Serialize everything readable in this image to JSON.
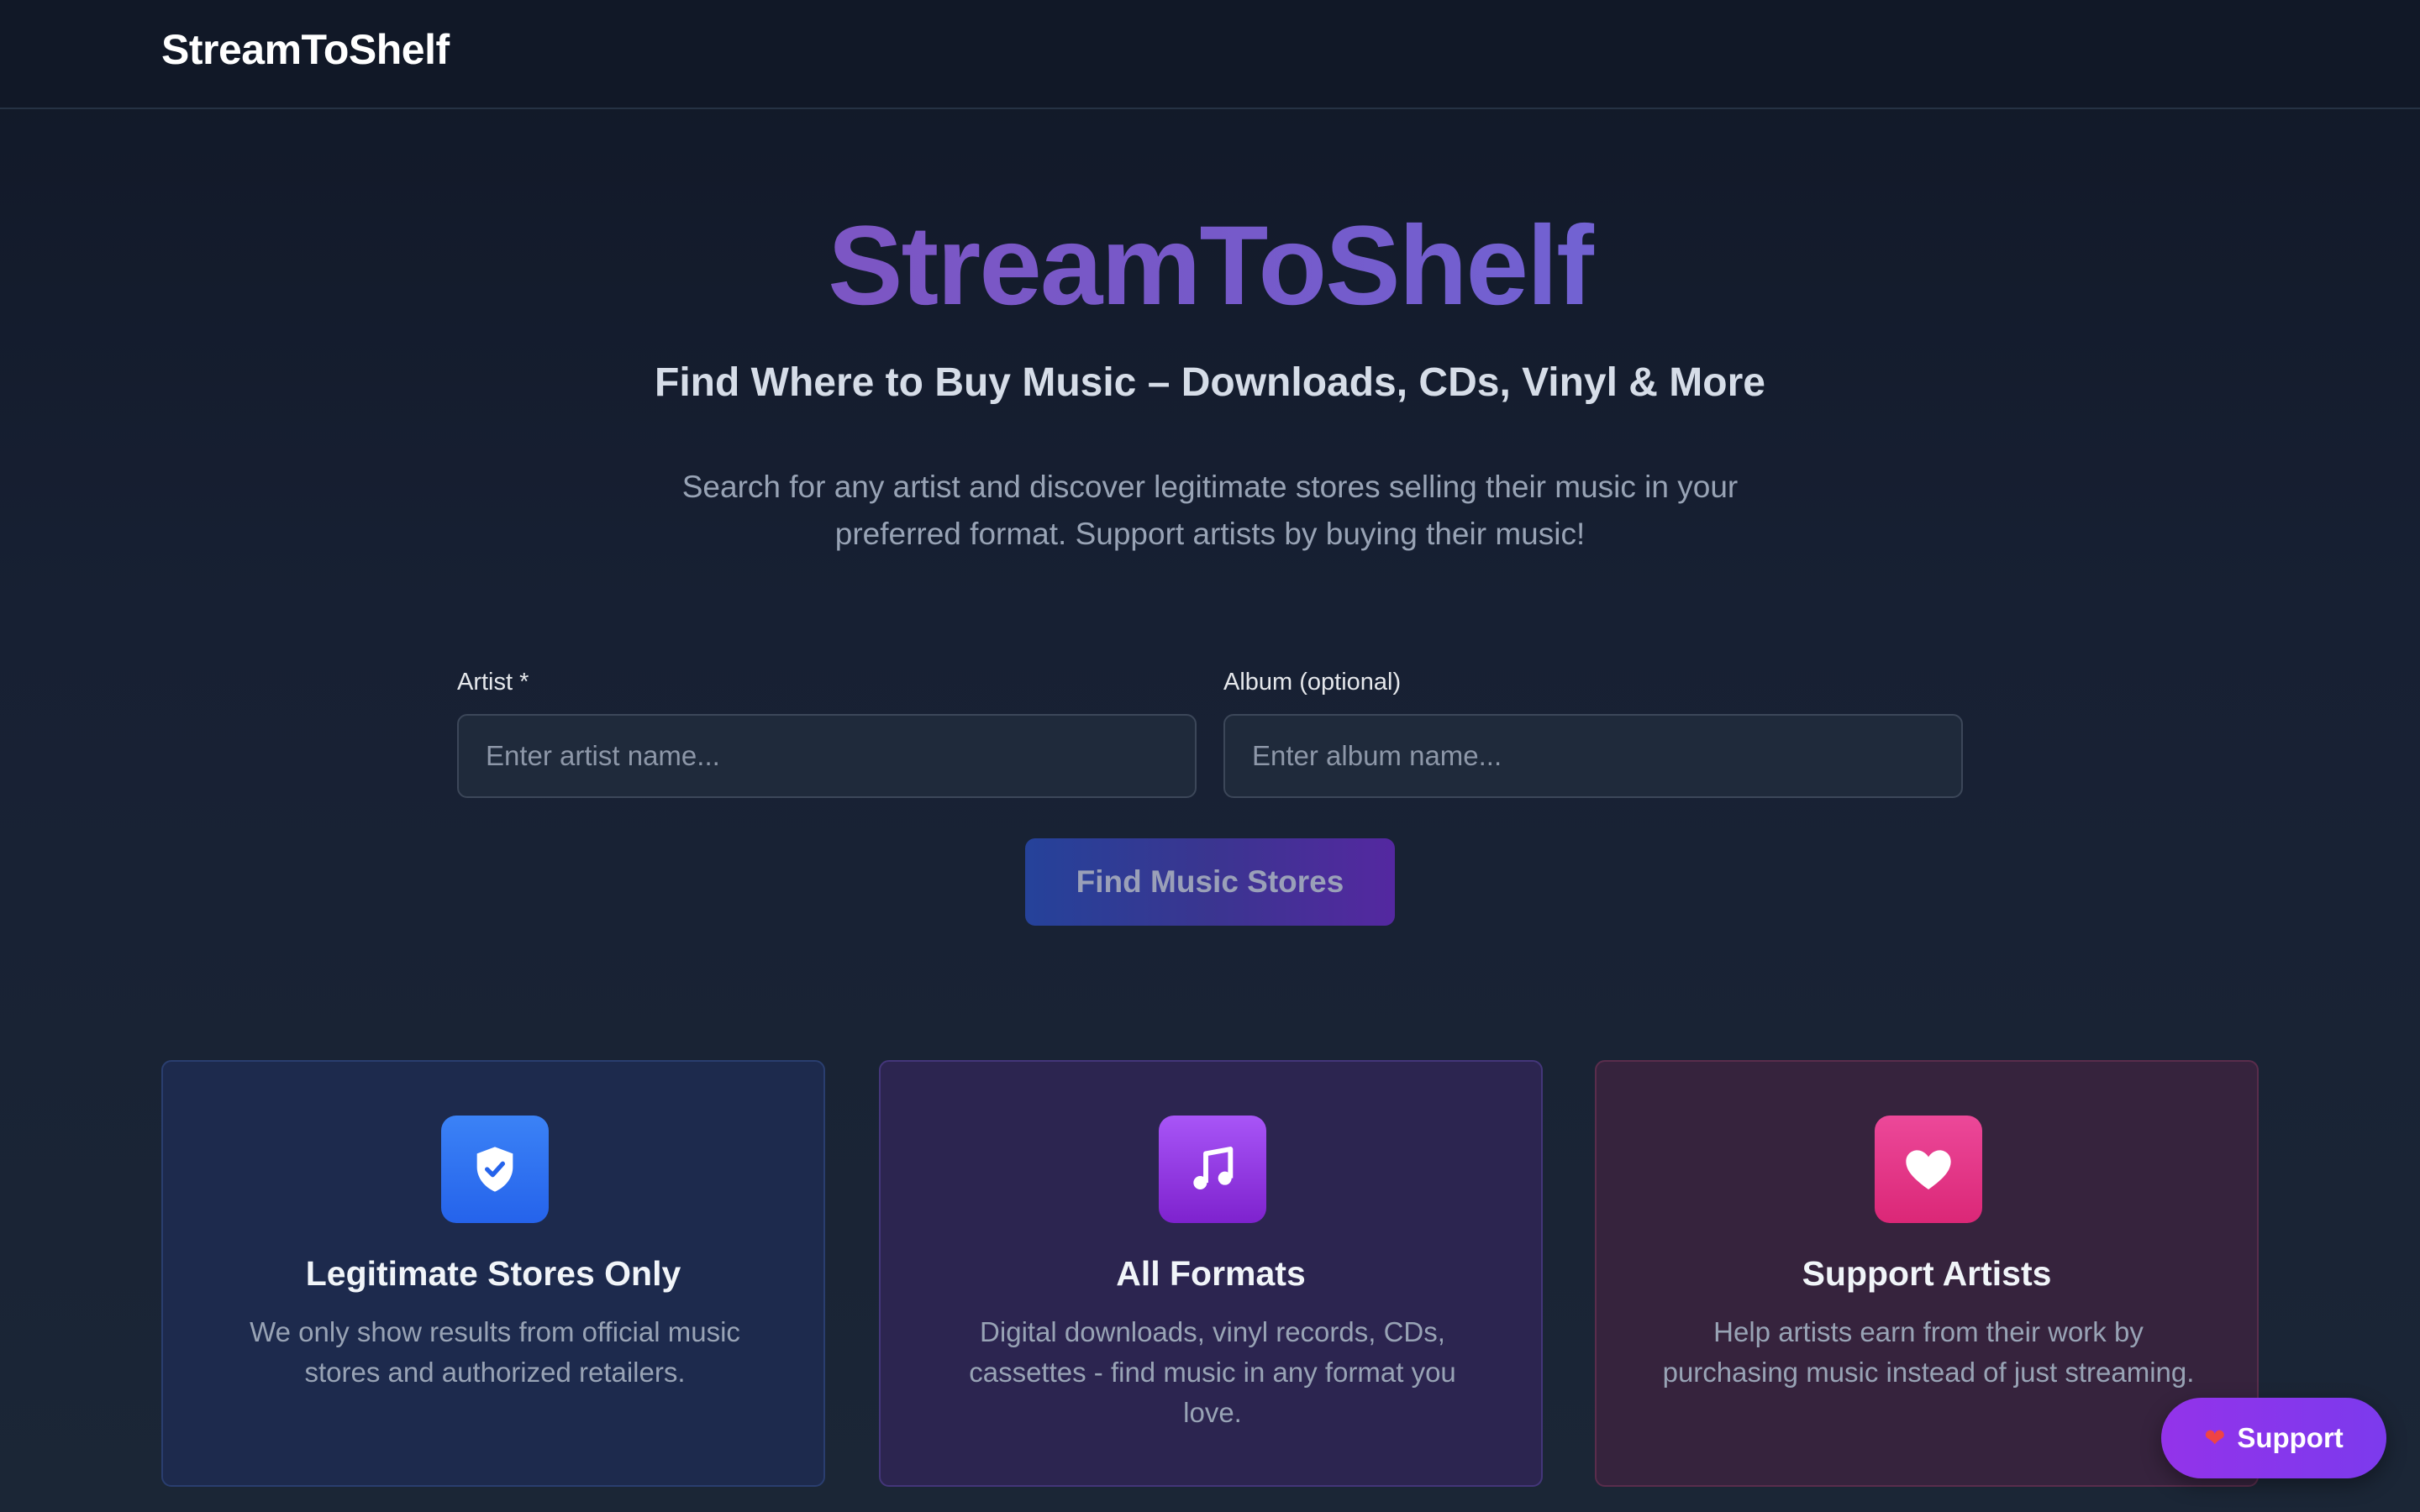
{
  "header": {
    "brand": "StreamToShelf"
  },
  "hero": {
    "title": "StreamToShelf",
    "subtitle": "Find Where to Buy Music – Downloads, CDs, Vinyl & More",
    "description": "Search for any artist and discover legitimate stores selling their music in your preferred format. Support artists by buying their music!"
  },
  "search": {
    "artist_label": "Artist *",
    "artist_placeholder": "Enter artist name...",
    "album_label": "Album (optional)",
    "album_placeholder": "Enter album name...",
    "submit_label": "Find Music Stores"
  },
  "features": [
    {
      "icon": "shield-check-icon",
      "title": "Legitimate Stores Only",
      "description": "We only show results from official music stores and authorized retailers."
    },
    {
      "icon": "music-note-icon",
      "title": "All Formats",
      "description": "Digital downloads, vinyl records, CDs, cassettes - find music in any format you love."
    },
    {
      "icon": "heart-icon",
      "title": "Support Artists",
      "description": "Help artists earn from their work by purchasing music instead of just streaming."
    }
  ],
  "support_button": {
    "label": "Support",
    "icon": "heart-emoji-icon"
  },
  "colors": {
    "accent_purple": "#7c3aed",
    "blue": "#2563eb",
    "pink": "#db2777",
    "background": "#111827"
  }
}
